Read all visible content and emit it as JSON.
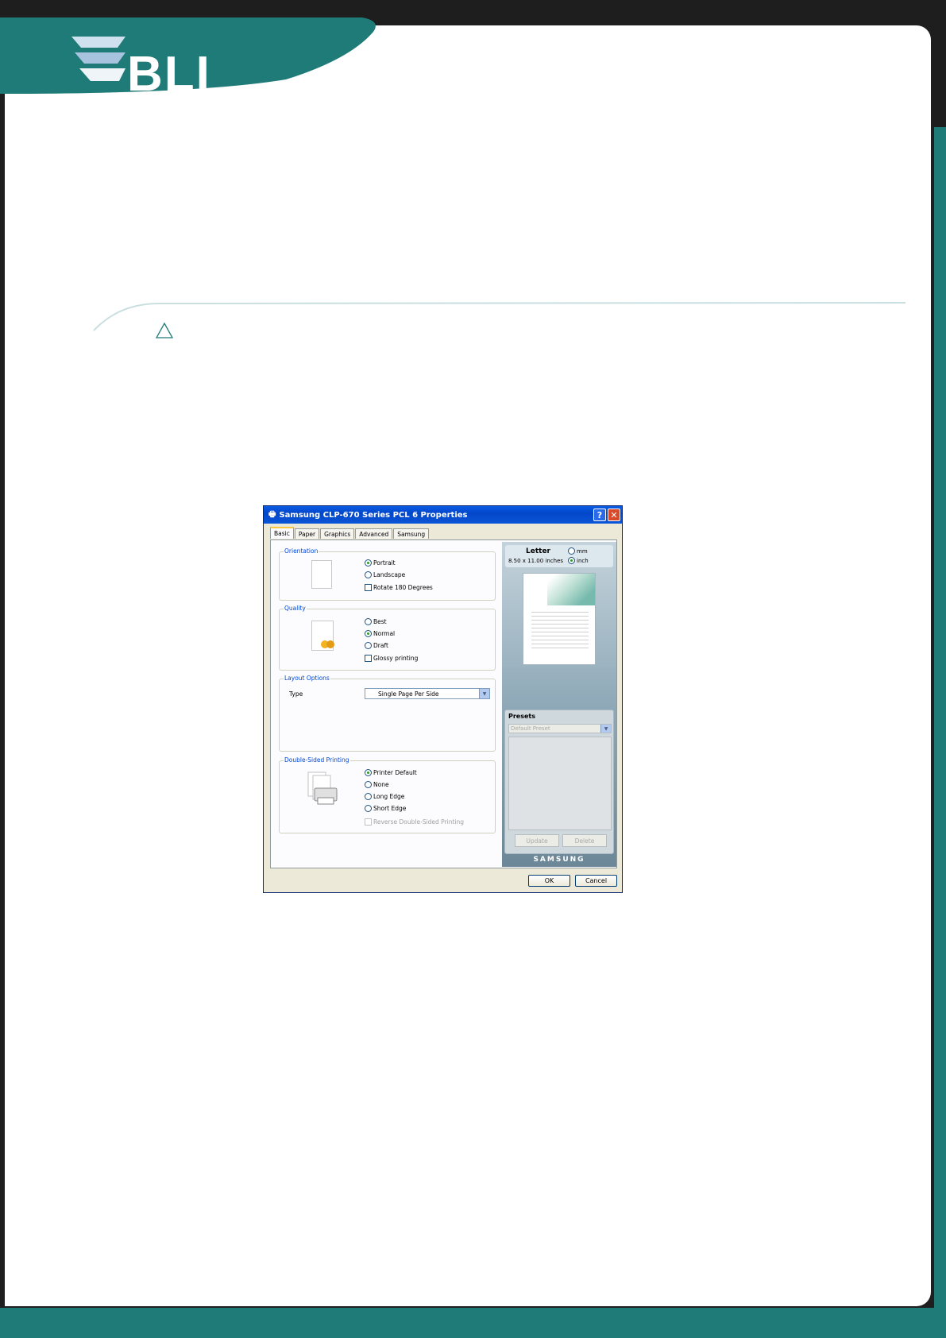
{
  "brand": {
    "logo": "BLI"
  },
  "icons": {
    "warning": "warning-triangle-icon"
  },
  "dialog": {
    "title": "Samsung CLP-670 Series PCL 6 Properties",
    "help_glyph": "?",
    "close_glyph": "✕",
    "tabs": [
      "Basic",
      "Paper",
      "Graphics",
      "Advanced",
      "Samsung"
    ],
    "orientation": {
      "label": "Orientation",
      "portrait": "Portrait",
      "landscape": "Landscape",
      "rotate": "Rotate 180 Degrees"
    },
    "quality": {
      "label": "Quality",
      "best": "Best",
      "normal": "Normal",
      "draft": "Draft",
      "glossy": "Glossy printing"
    },
    "layout": {
      "label": "Layout Options",
      "type_label": "Type",
      "type_value": "Single Page Per Side"
    },
    "duplex": {
      "label": "Double-Sided Printing",
      "printer_default": "Printer Default",
      "none": "None",
      "long_edge": "Long Edge",
      "short_edge": "Short Edge",
      "reverse": "Reverse Double-Sided Printing"
    },
    "paper": {
      "name": "Letter",
      "size": "8.50 x 11.00 inches",
      "mm": "mm",
      "inch": "inch"
    },
    "presets": {
      "label": "Presets",
      "value": "Default Preset",
      "update": "Update",
      "delete": "Delete"
    },
    "brand_name": "SAMSUNG",
    "ok": "OK",
    "cancel": "Cancel"
  }
}
